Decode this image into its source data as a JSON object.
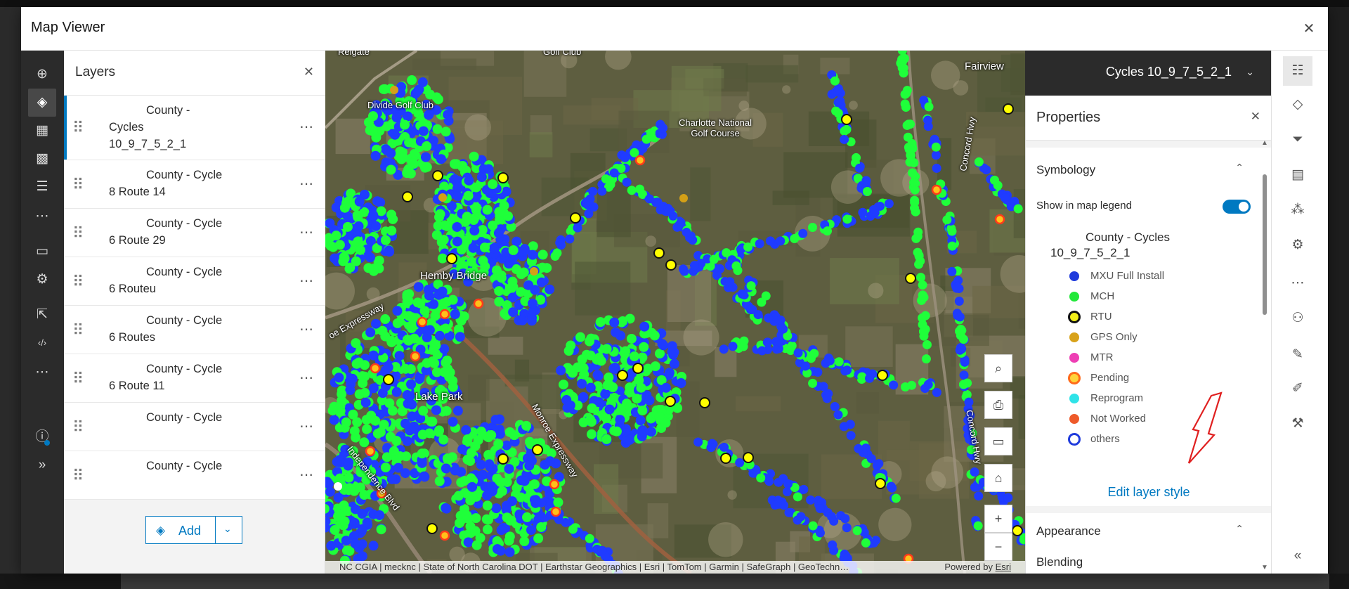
{
  "window": {
    "title": "Map Viewer",
    "close_glyph": "✕"
  },
  "left_rail": [
    {
      "name": "add-icon",
      "glyph": "⊕"
    },
    {
      "name": "layers-icon",
      "glyph": "◈",
      "active": true
    },
    {
      "name": "table-icon",
      "glyph": "▦"
    },
    {
      "name": "basemap-icon",
      "glyph": "▩"
    },
    {
      "name": "legend-icon",
      "glyph": "☰"
    },
    {
      "name": "more-icon",
      "glyph": "⋯"
    },
    {
      "name": "folder-icon",
      "glyph": "▭"
    },
    {
      "name": "settings-icon",
      "glyph": "⚙"
    },
    {
      "name": "share-icon",
      "glyph": "⇱"
    },
    {
      "name": "embed-icon",
      "glyph": "‹/›"
    },
    {
      "name": "more-icon-2",
      "glyph": "⋯"
    },
    {
      "name": "info-icon",
      "glyph": "ⓘ"
    },
    {
      "name": "expand-icon",
      "glyph": "»"
    }
  ],
  "layers_panel": {
    "title": "Layers",
    "close_glyph": "✕",
    "more_glyph": "⋯",
    "add_label": "Add",
    "items": [
      {
        "line1": "County -",
        "line2": "Cycles",
        "line3": "10_9_7_5_2_1",
        "selected": true
      },
      {
        "line1": "County - Cycle",
        "line2": "8 Route 14"
      },
      {
        "line1": "County - Cycle",
        "line2": "6 Route 29"
      },
      {
        "line1": "County - Cycle",
        "line2": "6 Routeu"
      },
      {
        "line1": "County - Cycle",
        "line2": "6 Routes"
      },
      {
        "line1": "County - Cycle",
        "line2": "6 Route 11"
      },
      {
        "line1": "County - Cycle",
        "line2": ""
      },
      {
        "line1": "County - Cycle",
        "line2": ""
      }
    ]
  },
  "map": {
    "labels": [
      {
        "text": "Reigate",
        "cls": "sm"
      },
      {
        "text": "Golf Club",
        "cls": "sm"
      },
      {
        "text": "Fairview",
        "cls": ""
      },
      {
        "text": "Divide Golf Club",
        "cls": "sm"
      },
      {
        "text": "Charlotte National Golf Course",
        "cls": "sm"
      },
      {
        "text": "Concord Hwy",
        "cls": "sm"
      },
      {
        "text": "Hemby Bridge",
        "cls": ""
      },
      {
        "text": "oe Expressway",
        "cls": "sm"
      },
      {
        "text": "Lake Park",
        "cls": ""
      },
      {
        "text": "Monroe Expressway",
        "cls": "sm"
      },
      {
        "text": "Independence Blvd",
        "cls": "sm"
      },
      {
        "text": "Concord Hwy",
        "cls": "sm"
      }
    ],
    "tools": [
      {
        "name": "search-icon",
        "glyph": "⌕"
      },
      {
        "name": "print-icon",
        "glyph": "⎙"
      },
      {
        "name": "fullscreen-icon",
        "glyph": "▭"
      },
      {
        "name": "home-icon",
        "glyph": "⌂"
      },
      {
        "name": "zoom-in-icon",
        "glyph": "+"
      },
      {
        "name": "zoom-out-icon",
        "glyph": "−"
      }
    ],
    "attribution": "NC CGIA | mecknc | State of North Carolina DOT | Earthstar Geographics | Esri | TomTom | Garmin | SafeGraph | GeoTechn…",
    "powered_by": "Powered by",
    "powered_esri": "Esri",
    "colors": {
      "mxu": "#1f3bff",
      "mch": "#1fff3a",
      "rtu": "#ffff00",
      "pending": "#ff3b1a",
      "gps": "#d4a017"
    }
  },
  "layer_dropdown": {
    "label": "Cycles 10_9_7_5_2_1",
    "caret": "⌄"
  },
  "properties": {
    "title": "Properties",
    "close_glyph": "✕",
    "symbology_title": "Symbology",
    "show_legend_label": "Show in map legend",
    "show_legend_on": true,
    "layer_name_line1": "County - Cycles",
    "layer_name_line2": "10_9_7_5_2_1",
    "legend": [
      {
        "label": "MXU Full Install",
        "fill": "#1f3bdc",
        "stroke": "#1f3bdc"
      },
      {
        "label": "MCH",
        "fill": "#22e83a",
        "stroke": "#22e83a"
      },
      {
        "label": "RTU",
        "fill": "#f2ef1a",
        "stroke": "#111111"
      },
      {
        "label": "GPS Only",
        "fill": "#d8a21a",
        "stroke": "#d8a21a"
      },
      {
        "label": "MTR",
        "fill": "#ee3fb4",
        "stroke": "#ee3fb4"
      },
      {
        "label": "Pending",
        "fill": "#ffd43a",
        "stroke": "#ff6a1a"
      },
      {
        "label": "Reprogram",
        "fill": "#2fe3e8",
        "stroke": "#2fe3e8"
      },
      {
        "label": "Not Worked",
        "fill": "#ee5a2a",
        "stroke": "#ee5a2a"
      },
      {
        "label": "others",
        "fill": "#ffffff",
        "stroke": "#1f3bdc"
      }
    ],
    "edit_layer_style": "Edit layer style",
    "appearance_title": "Appearance",
    "blending_label": "Blending"
  },
  "right_rail": [
    {
      "name": "properties-icon",
      "glyph": "☷",
      "active": true
    },
    {
      "name": "styles-icon",
      "glyph": "◇"
    },
    {
      "name": "filter-icon",
      "glyph": "⏷"
    },
    {
      "name": "pop-ups-icon",
      "glyph": "▤"
    },
    {
      "name": "clustering-icon",
      "glyph": "⁂"
    },
    {
      "name": "labels-icon",
      "glyph": "⚙"
    },
    {
      "name": "more-icon",
      "glyph": "⋯"
    },
    {
      "name": "sketch-icon",
      "glyph": "⚇"
    },
    {
      "name": "edit-icon",
      "glyph": "✎"
    },
    {
      "name": "draw-icon",
      "glyph": "✐"
    },
    {
      "name": "tools-icon",
      "glyph": "⚒"
    },
    {
      "name": "collapse-icon",
      "glyph": "«"
    }
  ]
}
